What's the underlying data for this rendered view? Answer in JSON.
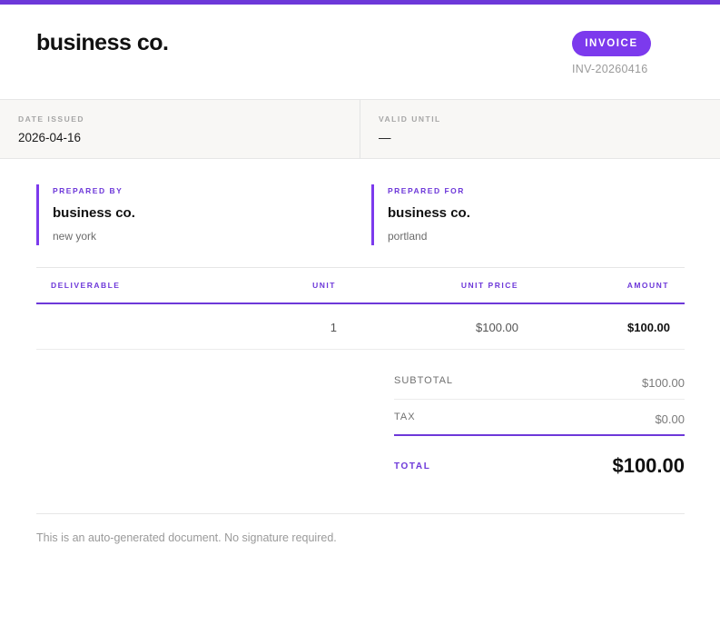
{
  "header": {
    "company": "business co.",
    "badge": "INVOICE",
    "invoice_number": "INV-20260416"
  },
  "dates": {
    "issued_label": "DATE ISSUED",
    "issued_value": "2026-04-16",
    "valid_label": "VALID UNTIL",
    "valid_value": "—"
  },
  "parties": {
    "from": {
      "label": "PREPARED BY",
      "name": "business co.",
      "location": "new york"
    },
    "to": {
      "label": "PREPARED FOR",
      "name": "business co.",
      "location": "portland"
    }
  },
  "items": {
    "columns": {
      "desc": "DELIVERABLE",
      "unit": "UNIT",
      "price": "UNIT PRICE",
      "amount": "AMOUNT"
    },
    "rows": [
      {
        "desc": "",
        "unit": "1",
        "price": "$100.00",
        "amount": "$100.00"
      }
    ]
  },
  "totals": {
    "subtotal_label": "SUBTOTAL",
    "subtotal_value": "$100.00",
    "tax_label": "TAX",
    "tax_value": "$0.00",
    "total_label": "TOTAL",
    "total_value": "$100.00"
  },
  "footer": {
    "note": "This is an auto-generated document. No signature required."
  },
  "colors": {
    "accent": "#7c3aed",
    "accent_dark": "#6d38d9"
  }
}
